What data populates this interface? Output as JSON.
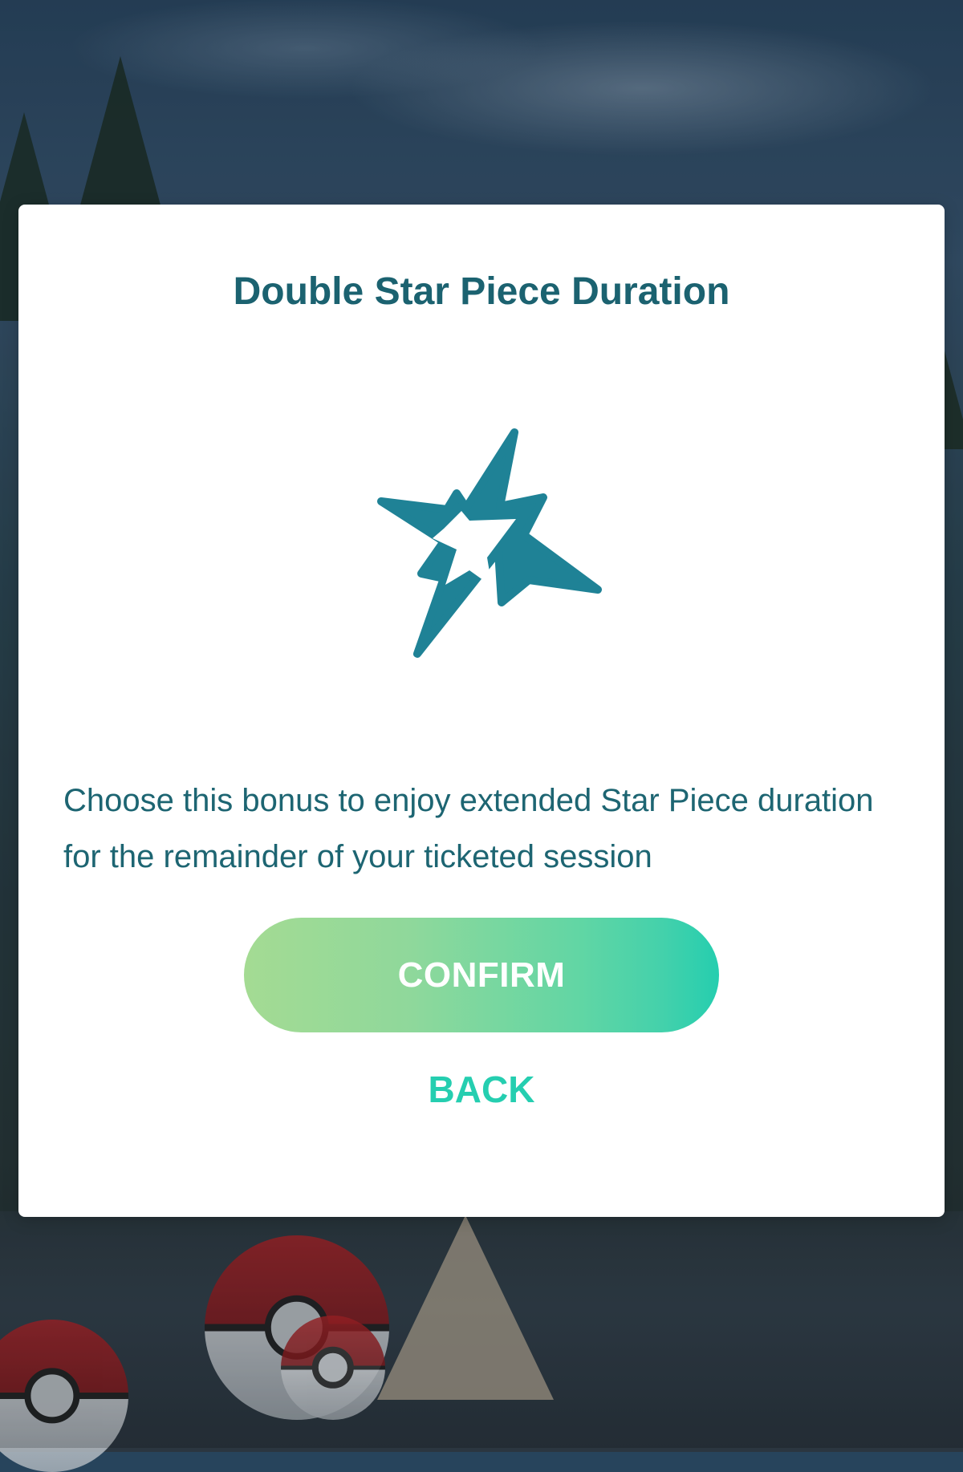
{
  "dialog": {
    "title": "Double Star Piece Duration",
    "icon": "star-piece-icon",
    "description": "Choose this bonus to enjoy extended Star Piece duration for the remainder of your ticketed session",
    "confirm_label": "CONFIRM",
    "back_label": "BACK"
  },
  "colors": {
    "title": "#1b6270",
    "text": "#1d6572",
    "icon": "#1f8296",
    "accent": "#25ceb0",
    "confirm_gradient_start": "#a4db93",
    "confirm_gradient_end": "#25ceaf"
  }
}
